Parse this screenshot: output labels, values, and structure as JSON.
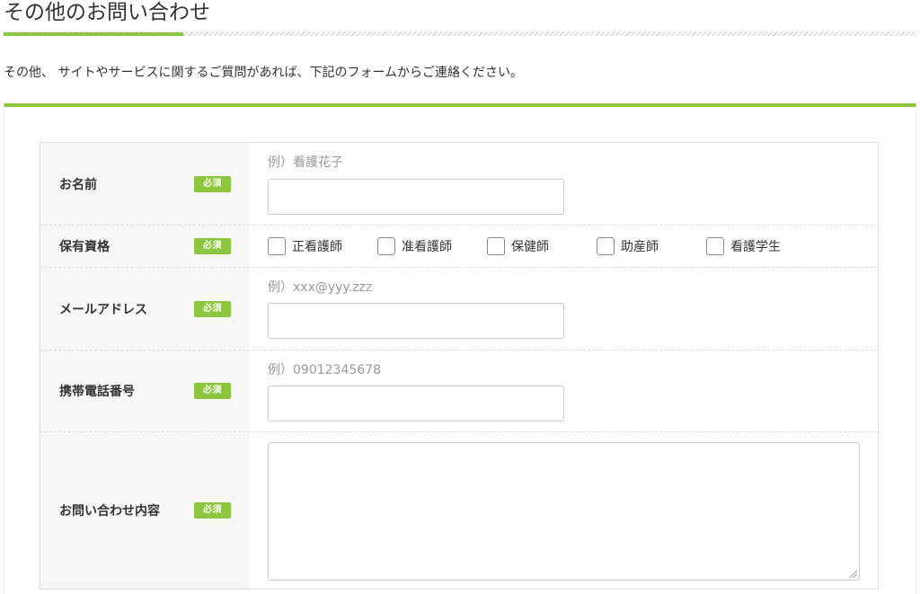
{
  "header": {
    "title": "その他のお問い合わせ"
  },
  "intro": {
    "text": "その他、 サイトやサービスに関するご質問があれば、下記のフォームからご連絡ください。"
  },
  "accent_color": "#8cc63f",
  "form": {
    "required_badge": "必須",
    "name": {
      "label": "お名前",
      "example": "例）看護花子",
      "value": ""
    },
    "qualification": {
      "label": "保有資格",
      "options": [
        {
          "label": "正看護師",
          "checked": false
        },
        {
          "label": "准看護師",
          "checked": false
        },
        {
          "label": "保健師",
          "checked": false
        },
        {
          "label": "助産師",
          "checked": false
        },
        {
          "label": "看護学生",
          "checked": false
        }
      ]
    },
    "email": {
      "label": "メールアドレス",
      "example": "例）xxx@yyy.zzz",
      "value": ""
    },
    "phone": {
      "label": "携帯電話番号",
      "example": "例）09012345678",
      "value": ""
    },
    "inquiry": {
      "label": "お問い合わせ内容",
      "value": ""
    }
  }
}
